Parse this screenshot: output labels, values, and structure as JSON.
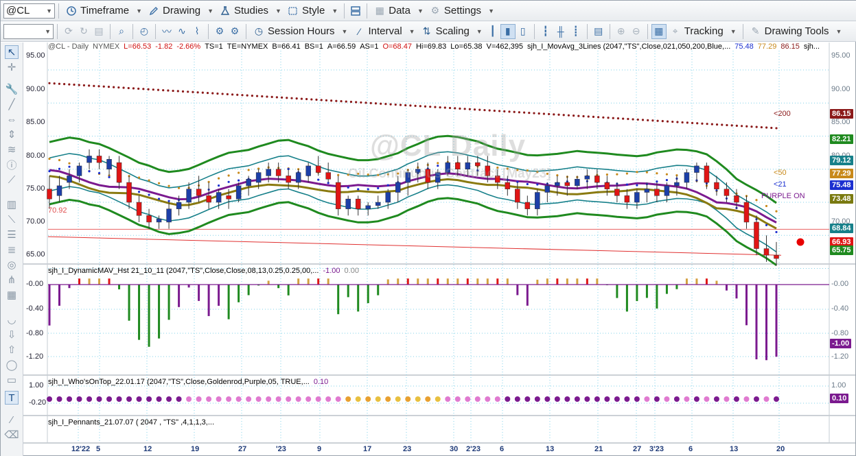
{
  "toolbar1": {
    "symbol": "@CL",
    "timeframe": "Timeframe",
    "drawing": "Drawing",
    "studies": "Studies",
    "style": "Style",
    "data": "Data",
    "settings": "Settings"
  },
  "toolbar2": {
    "session_hours": "Session Hours",
    "interval": "Interval",
    "scaling": "Scaling",
    "tracking": "Tracking",
    "drawing_tools": "Drawing Tools"
  },
  "price_header": {
    "symbol": "@CL - Daily",
    "exchange": "NYMEX",
    "last": "L=66.53",
    "change": "-1.82",
    "change_pct": "-2.66%",
    "ts": "TS=1",
    "te": "TE=NYMEX",
    "bid": "B=66.41",
    "bid_size": "BS=1",
    "ask": "A=66.59",
    "ask_size": "AS=1",
    "open": "O=68.47",
    "high": "Hi=69.83",
    "low": "Lo=65.38",
    "volume": "V=462,395",
    "study": "sjh_I_MovAvg_3Lines (2047,\"TS\",Close,021,050,200,Blue,...",
    "v1": "75.48",
    "v2": "77.29",
    "v3": "86.15",
    "more": "sjh..."
  },
  "watermark": {
    "title": "@CL Daily",
    "subtitle": "Oil Continuous Contract [May23]"
  },
  "price_axis": [
    "95.00",
    "90.00",
    "85.00",
    "80.00",
    "75.00",
    "70.00",
    "65.00"
  ],
  "hline_label": "70.92",
  "ma_labels": {
    "ma200": "<200",
    "ma50": "<50",
    "ma21": "<21",
    "purple": "PURPLE ON"
  },
  "price_tags": [
    {
      "text": "86.15",
      "color": "#8b1a1a"
    },
    {
      "text": "82.21",
      "color": "#1f8a1f"
    },
    {
      "text": "79.12",
      "color": "#17808a"
    },
    {
      "text": "77.29",
      "color": "#c8891a"
    },
    {
      "text": "75.48",
      "color": "#1b2fd0"
    },
    {
      "text": "73.48",
      "color": "#7a7a10"
    },
    {
      "text": "68.84",
      "color": "#17808a"
    },
    {
      "text": "66.93",
      "color": "#e01515"
    },
    {
      "text": "65.75",
      "color": "#1f8a1f"
    }
  ],
  "indicator1": {
    "label": "sjh_I_DynamicMAV_Hst 21_10_11 (2047,\"TS\",Close,Close,08,13,0.25,0.25,00,...",
    "v1": "-1.00",
    "v2": "0.00",
    "axis": [
      "-0.00",
      "-0.40",
      "-0.80",
      "-1.20"
    ],
    "tag": "-1.00"
  },
  "indicator2": {
    "label": "sjh_I_Who'sOnTop_22.01.17 (2047,\"TS\",Close,Goldenrod,Purple,05, TRUE,...",
    "v1": "0.10",
    "axis": [
      "1.00",
      "-0.20"
    ],
    "tag": "0.10"
  },
  "indicator3": {
    "label": "sjh_I_Pennants_21.07.07 ( 2047 , \"TS\" ,4,1,1,3,..."
  },
  "x_axis": [
    "12'22",
    "5",
    "12",
    "19",
    "27",
    "'23",
    "9",
    "17",
    "23",
    "30",
    "2'23",
    "6",
    "13",
    "21",
    "27",
    "3'23",
    "6",
    "13",
    "20"
  ],
  "chart_data": {
    "type": "candlestick",
    "ylim": [
      64,
      96
    ],
    "candles": [
      [
        77,
        79,
        74,
        75.5
      ],
      [
        76,
        79,
        75,
        77.5
      ],
      [
        78,
        80,
        77,
        79
      ],
      [
        79,
        81,
        78,
        80.5
      ],
      [
        81,
        83,
        80,
        82
      ],
      [
        82,
        83,
        80,
        81
      ],
      [
        80,
        82,
        79,
        81.5
      ],
      [
        81,
        82,
        77,
        78
      ],
      [
        78,
        79,
        74,
        75
      ],
      [
        75,
        76,
        72,
        73
      ],
      [
        73,
        74,
        71,
        72
      ],
      [
        72,
        73,
        71,
        72.5
      ],
      [
        72,
        75,
        71,
        74
      ],
      [
        74,
        76,
        73,
        75
      ],
      [
        75,
        78,
        74,
        77
      ],
      [
        77,
        79,
        75,
        76
      ],
      [
        76,
        78,
        74,
        75
      ],
      [
        75,
        77,
        74,
        76.5
      ],
      [
        76,
        77,
        74,
        75.5
      ],
      [
        75.5,
        78,
        75,
        77.5
      ],
      [
        77.5,
        79,
        76,
        78.5
      ],
      [
        78,
        80,
        77,
        79.5
      ],
      [
        79,
        81,
        78,
        80
      ],
      [
        80,
        81,
        78,
        79
      ],
      [
        79,
        80,
        77,
        78
      ],
      [
        78,
        80,
        77,
        79.5
      ],
      [
        79,
        81,
        78,
        80.5
      ],
      [
        80.5,
        82,
        79,
        79.5
      ],
      [
        79.5,
        81,
        78,
        78.5
      ],
      [
        78,
        79,
        73,
        74
      ],
      [
        74,
        76,
        73,
        75.5
      ],
      [
        75.5,
        76,
        73,
        74
      ],
      [
        74,
        75,
        73,
        74.5
      ],
      [
        74.5,
        76,
        74,
        75
      ],
      [
        75,
        77,
        74,
        76.5
      ],
      [
        76.5,
        79,
        75,
        78
      ],
      [
        78,
        80,
        76,
        79.5
      ],
      [
        79.5,
        81,
        78,
        80
      ],
      [
        80,
        81,
        77,
        78
      ],
      [
        78,
        80,
        77,
        79.5
      ],
      [
        79.5,
        82,
        79,
        81
      ],
      [
        81,
        82,
        79,
        80
      ],
      [
        80,
        82,
        79,
        81
      ],
      [
        81,
        82,
        79,
        80.5
      ],
      [
        80.5,
        82,
        78,
        79
      ],
      [
        79,
        80,
        77,
        78
      ],
      [
        78,
        79,
        76,
        77
      ],
      [
        77,
        78,
        74,
        75
      ],
      [
        75,
        76,
        73,
        74
      ],
      [
        74,
        77,
        73,
        76.5
      ],
      [
        76.5,
        78,
        75,
        77.5
      ],
      [
        77.5,
        79,
        76,
        78
      ],
      [
        78,
        79,
        76,
        77.5
      ],
      [
        77.5,
        79,
        77,
        78.5
      ],
      [
        78.5,
        80,
        77,
        79
      ],
      [
        79,
        80,
        77,
        78
      ],
      [
        78,
        79,
        76,
        77
      ],
      [
        77,
        78,
        75,
        76
      ],
      [
        76,
        77,
        74,
        75
      ],
      [
        75,
        77,
        74,
        76.5
      ],
      [
        76.5,
        78,
        75,
        77
      ],
      [
        77,
        78,
        75,
        76
      ],
      [
        76,
        78,
        75,
        77.5
      ],
      [
        77.5,
        79,
        76,
        78
      ],
      [
        78,
        80,
        77,
        79.5
      ],
      [
        79.5,
        81,
        78,
        80.5
      ],
      [
        80.5,
        81,
        77,
        78
      ],
      [
        78,
        79,
        76,
        77
      ],
      [
        77,
        78,
        75,
        76
      ],
      [
        76,
        77,
        74,
        75
      ],
      [
        75,
        76,
        71,
        72
      ],
      [
        72,
        73,
        67,
        68
      ],
      [
        68,
        70,
        66,
        67
      ],
      [
        67,
        69,
        65.4,
        66.5
      ]
    ]
  }
}
